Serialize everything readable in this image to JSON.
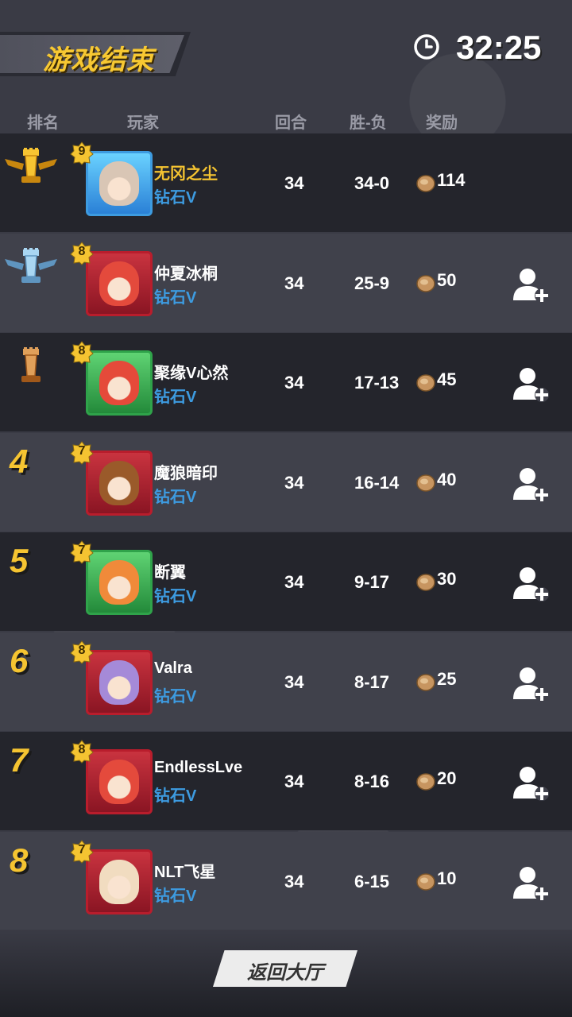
{
  "header": {
    "title": "游戏结束",
    "timer": "32:25"
  },
  "columns": {
    "rank": "排名",
    "player": "玩家",
    "rounds": "回合",
    "win_loss": "胜-负",
    "reward": "奖励"
  },
  "rows": [
    {
      "rank": "1",
      "trophy": "gold",
      "level": "9",
      "name": "无冈之尘",
      "tier": "钻石V",
      "rounds": "34",
      "wl": "34-0",
      "reward": "114",
      "frame": "blue",
      "face": "#d9c6b5",
      "self": true
    },
    {
      "rank": "2",
      "trophy": "silver",
      "level": "8",
      "name": "仲夏冰桐",
      "tier": "钻石V",
      "rounds": "34",
      "wl": "25-9",
      "reward": "50",
      "frame": "red",
      "face": "#e44a3c"
    },
    {
      "rank": "3",
      "trophy": "bronze",
      "level": "8",
      "name": "聚缘V心然",
      "tier": "钻石V",
      "rounds": "34",
      "wl": "17-13",
      "reward": "45",
      "frame": "green",
      "face": "#e54a3a"
    },
    {
      "rank": "4",
      "level": "7",
      "name": "魔狼暗印",
      "tier": "钻石V",
      "rounds": "34",
      "wl": "16-14",
      "reward": "40",
      "frame": "red",
      "face": "#9a5a2a"
    },
    {
      "rank": "5",
      "level": "7",
      "name": "断翼",
      "tier": "钻石V",
      "rounds": "34",
      "wl": "9-17",
      "reward": "30",
      "frame": "green",
      "face": "#f08a3a"
    },
    {
      "rank": "6",
      "level": "8",
      "name": "Valra",
      "tier": "钻石V",
      "rounds": "34",
      "wl": "8-17",
      "reward": "25",
      "frame": "red",
      "face": "#a58ad8"
    },
    {
      "rank": "7",
      "level": "8",
      "name": "EndlessLve",
      "tier": "钻石V",
      "rounds": "34",
      "wl": "8-16",
      "reward": "20",
      "frame": "red",
      "face": "#e44a3c"
    },
    {
      "rank": "8",
      "level": "7",
      "name": "NLT飞星",
      "tier": "钻石V",
      "rounds": "34",
      "wl": "6-15",
      "reward": "10",
      "frame": "red",
      "face": "#f1dcc0"
    }
  ],
  "footer": {
    "return_label": "返回大厅"
  },
  "colors": {
    "accent": "#f5c431",
    "tier": "#3d9be0"
  }
}
